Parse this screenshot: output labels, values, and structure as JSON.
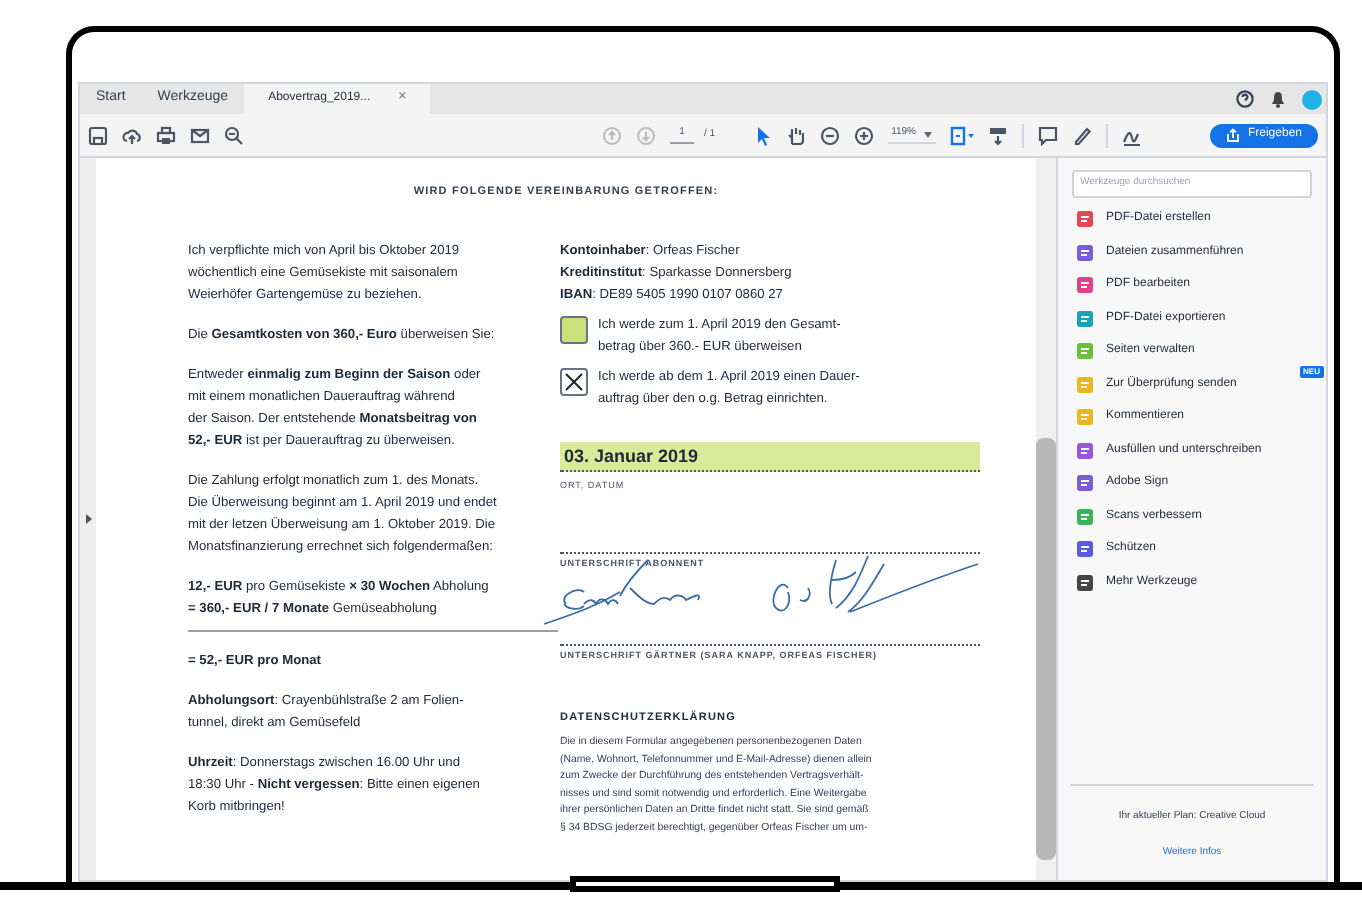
{
  "tabs": [
    {
      "label": "Start",
      "selected": false
    },
    {
      "label": "Werkzeuge",
      "selected": false
    },
    {
      "label": "Abovertrag_2019...",
      "selected": true,
      "close": "×"
    }
  ],
  "toolbar": {
    "page": "1",
    "page_total": "/ 1",
    "zoom": "119%",
    "share_button": "Freigeben"
  },
  "document": {
    "heading": "WIRD FOLGENDE VEREINBARUNG GETROFFEN:",
    "left_paragraphs": [
      {
        "kind": "text",
        "divider_after": false,
        "lines": [
          "Ich verpflichte mich von April bis Oktober 2019",
          "wöchentlich eine Gemüsekiste mit saisonalem",
          "Weierhöfer Gartengemüse zu beziehen."
        ]
      },
      {
        "kind": "text",
        "divider_after": false,
        "lines": [
          "Die **Gesamtkosten von 360,- Euro** überweisen Sie:"
        ]
      },
      {
        "kind": "text",
        "divider_after": false,
        "lines": [
          "Entweder **einmalig zum Beginn der Saison** oder",
          "mit einem monatlichen Dauerauftrag während",
          "der Saison. Der entstehende **Monatsbeitrag von**",
          "**52,- EUR** ist per Dauerauftrag zu überweisen."
        ]
      },
      {
        "kind": "text",
        "divider_after": false,
        "lines": [
          "Die Zahlung erfolgt monatlich zum 1. des Monats.",
          "Die Überweisung beginnt am 1. April 2019 und endet",
          "mit der letzen Überweisung am 1. Oktober 2019. Die",
          "Monatsfinanzierung errechnet sich folgendermaßen:"
        ]
      },
      {
        "kind": "text",
        "divider_after": true,
        "lines": [
          "**12,- EUR** pro Gemüsekiste **× 30 Wochen** Abholung",
          "**= 360,- EUR / 7 Monate** Gemüseabholung"
        ]
      },
      {
        "kind": "total",
        "divider_after": false,
        "lines": [
          "= 52,- EUR pro Monat"
        ]
      },
      {
        "kind": "text",
        "divider_after": false,
        "lines": [
          "**Abholungsort**: Crayenbühlstraße 2 am Folien-",
          "tunnel, direkt am Gemüsefeld"
        ]
      },
      {
        "kind": "text",
        "divider_after": false,
        "lines": [
          "**Uhrzeit**: Donnerstags zwischen 16.00 Uhr und",
          "18:30 Uhr - **Nicht vergessen**: Bitte einen eigenen",
          "Korb mitbringen!"
        ]
      }
    ],
    "account_lines": [
      "**Kontoinhaber**: Orfeas Fischer",
      "**Kreditinstitut**: Sparkasse Donnersberg",
      "**IBAN**: DE89 5405 1990 0107 0860 27"
    ],
    "options": [
      {
        "lines": [
          "Ich werde zum 1. April 2019 den Gesamt-",
          "betrag über 360.- EUR überweisen"
        ],
        "checked": false
      },
      {
        "lines": [
          "Ich werde ab dem 1. April 2019 einen Dauer-",
          "auftrag über den o.g. Betrag einrichten."
        ],
        "checked": true
      }
    ],
    "date": "03. Januar 2019",
    "date_label": "ORT, DATUM",
    "subscriber_label": "UNTERSCHRIFT ABONNENT",
    "gardener_label": "UNTERSCHRIFT GÄRTNER (SARA KNAPP, ORFEAS FISCHER)",
    "privacy_title": "DATENSCHUTZERKLÄRUNG",
    "privacy_lines": [
      "Die in diesem Formular angegebenen personenbezogenen Daten",
      "(Name, Wohnort, Telefonnummer und E-Mail-Adresse) dienen allein",
      "zum Zwecke der Durchführung des entstehenden Vertragsverhält-",
      "nisses und sind somit notwendig und erforderlich. Eine Weitergabe",
      "ihrer persönlichen Daten an Dritte findet nicht statt. Sie sind gemäß",
      "§ 34 BDSG jederzeit berechtigt, gegenüber Orfeas Fischer um um-"
    ]
  },
  "tools_panel": {
    "search_placeholder": "Werkzeuge durchsuchen",
    "tools": [
      {
        "label": "PDF-Datei erstellen",
        "color": "#e34850"
      },
      {
        "label": "Dateien zusammenführen",
        "color": "#7b5cd6"
      },
      {
        "label": "PDF bearbeiten",
        "color": "#e0408a"
      },
      {
        "label": "PDF-Datei exportieren",
        "color": "#19a3b8"
      },
      {
        "label": "Seiten verwalten",
        "color": "#6cbf3a"
      },
      {
        "label": "Zur Überprüfung senden",
        "color": "#e8b81c",
        "badge": "NEU"
      },
      {
        "label": "Kommentieren",
        "color": "#e8b81c"
      },
      {
        "label": "Ausfüllen und unterschreiben",
        "color": "#9a55e0"
      },
      {
        "label": "Adobe Sign",
        "color": "#7b5cd6"
      },
      {
        "label": "Scans verbessern",
        "color": "#3cb25a"
      },
      {
        "label": "Schützen",
        "color": "#5a5ae0"
      },
      {
        "label": "Mehr Werkzeuge",
        "color": "#444444"
      }
    ],
    "plan": "Ihr aktueller Plan: Creative Cloud",
    "more_info": "Weitere Infos"
  }
}
